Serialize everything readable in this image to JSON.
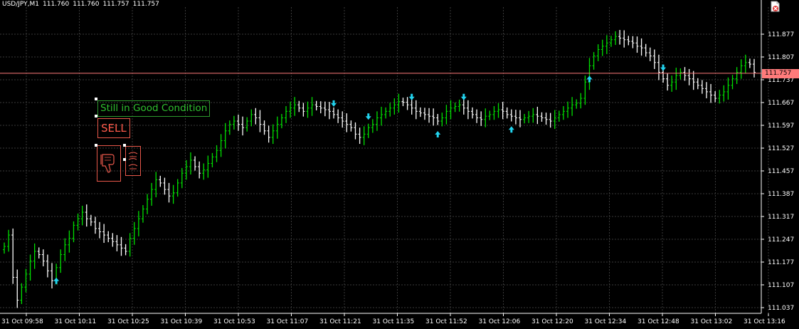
{
  "header": {
    "symbol": "USD/JPY,M1",
    "open": "111.760",
    "high": "111.760",
    "low": "111.757",
    "close": "111.757"
  },
  "labels": {
    "status": "Still in Good Condition",
    "signal": "SELL"
  },
  "current_price": "111.757",
  "colors": {
    "background": "#000000",
    "grid": "#3a3a3a",
    "bull_bar": "#00e000",
    "bear_bar": "#ffffff",
    "arrow": "#22d3ee",
    "price_line": "#ff7b7b",
    "status_text": "#2fc02f",
    "signal": "#ff5a4a"
  },
  "icons": {
    "close": "close-icon",
    "thumbs_down": "thumbs-down-icon",
    "hand_pointing": "hand-pointing-icon"
  },
  "chart_data": {
    "type": "ohlc",
    "ylim": [
      111.0,
      111.9
    ],
    "y_ticks": [
      "111.877",
      "111.807",
      "111.737",
      "111.667",
      "111.597",
      "111.527",
      "111.457",
      "111.387",
      "111.317",
      "111.247",
      "111.177",
      "111.107",
      "111.037"
    ],
    "x_ticks": [
      "31 Oct 09:58",
      "31 Oct 10:11",
      "31 Oct 10:25",
      "31 Oct 10:39",
      "31 Oct 10:53",
      "31 Oct 11:07",
      "31 Oct 11:21",
      "31 Oct 11:35",
      "31 Oct 11:52",
      "31 Oct 12:06",
      "31 Oct 12:20",
      "31 Oct 12:34",
      "31 Oct 12:48",
      "31 Oct 13:02",
      "31 Oct 13:16"
    ],
    "closes": [
      111.225,
      111.26,
      111.13,
      111.06,
      111.1,
      111.14,
      111.18,
      111.21,
      111.2,
      111.18,
      111.15,
      111.12,
      111.16,
      111.2,
      111.23,
      111.25,
      111.29,
      111.31,
      111.33,
      111.31,
      111.3,
      111.28,
      111.27,
      111.26,
      111.25,
      111.24,
      111.23,
      111.22,
      111.21,
      111.25,
      111.28,
      111.31,
      111.34,
      111.37,
      111.4,
      111.43,
      111.42,
      111.4,
      111.38,
      111.39,
      111.42,
      111.45,
      111.47,
      111.49,
      111.47,
      111.45,
      111.46,
      111.48,
      111.5,
      111.52,
      111.55,
      111.58,
      111.6,
      111.61,
      111.6,
      111.59,
      111.61,
      111.63,
      111.62,
      111.6,
      111.58,
      111.56,
      111.58,
      111.6,
      111.62,
      111.64,
      111.65,
      111.66,
      111.65,
      111.64,
      111.65,
      111.66,
      111.655,
      111.65,
      111.645,
      111.64,
      111.63,
      111.62,
      111.61,
      111.6,
      111.59,
      111.57,
      111.56,
      111.57,
      111.59,
      111.6,
      111.62,
      111.63,
      111.64,
      111.65,
      111.66,
      111.67,
      111.668,
      111.66,
      111.65,
      111.64,
      111.635,
      111.63,
      111.625,
      111.62,
      111.61,
      111.62,
      111.64,
      111.65,
      111.655,
      111.66,
      111.65,
      111.64,
      111.63,
      111.62,
      111.615,
      111.625,
      111.63,
      111.64,
      111.645,
      111.64,
      111.63,
      111.625,
      111.62,
      111.615,
      111.62,
      111.625,
      111.63,
      111.625,
      111.62,
      111.615,
      111.61,
      111.62,
      111.63,
      111.64,
      111.65,
      111.66,
      111.665,
      111.68,
      111.73,
      111.78,
      111.81,
      111.83,
      111.84,
      111.85,
      111.86,
      111.87,
      111.865,
      111.86,
      111.855,
      111.85,
      111.84,
      111.835,
      111.82,
      111.81,
      111.79,
      111.76,
      111.74,
      111.72,
      111.73,
      111.75,
      111.76,
      111.75,
      111.74,
      111.73,
      111.72,
      111.71,
      111.7,
      111.69,
      111.68,
      111.69,
      111.7,
      111.72,
      111.74,
      111.76,
      111.78,
      111.79,
      111.785,
      111.76
    ],
    "arrows": [
      {
        "bar": 12,
        "direction": "up"
      },
      {
        "bar": 76,
        "direction": "down"
      },
      {
        "bar": 84,
        "direction": "down"
      },
      {
        "bar": 94,
        "direction": "down"
      },
      {
        "bar": 100,
        "direction": "up"
      },
      {
        "bar": 106,
        "direction": "down"
      },
      {
        "bar": 117,
        "direction": "up"
      },
      {
        "bar": 135,
        "direction": "up"
      },
      {
        "bar": 152,
        "direction": "down"
      }
    ]
  }
}
